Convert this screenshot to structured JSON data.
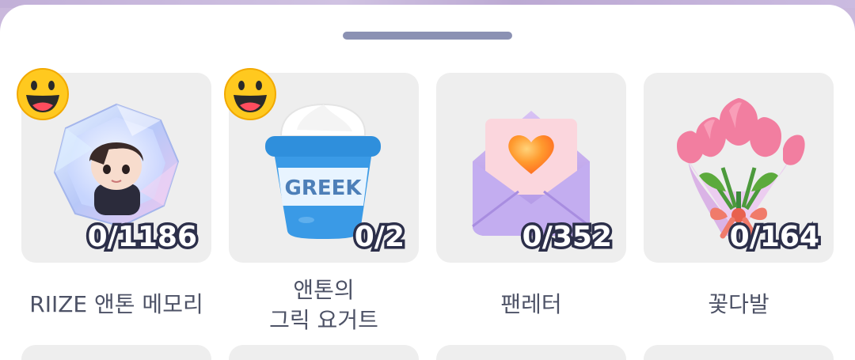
{
  "items": [
    {
      "name": "RIIZE 앤톤 메모리",
      "count": "0/1186",
      "badge": "smiley-icon"
    },
    {
      "name_line1": "앤톤의",
      "name_line2": "그릭 요거트",
      "count": "0/2",
      "badge": "smiley-icon"
    },
    {
      "name": "팬레터",
      "count": "0/352"
    },
    {
      "name": "꽃다발",
      "count": "0/164"
    }
  ],
  "colors": {
    "card_bg": "#eeeeee",
    "label_text": "#4d5266",
    "handle": "#8b91b3",
    "count_stroke": "#2c2f4a"
  }
}
